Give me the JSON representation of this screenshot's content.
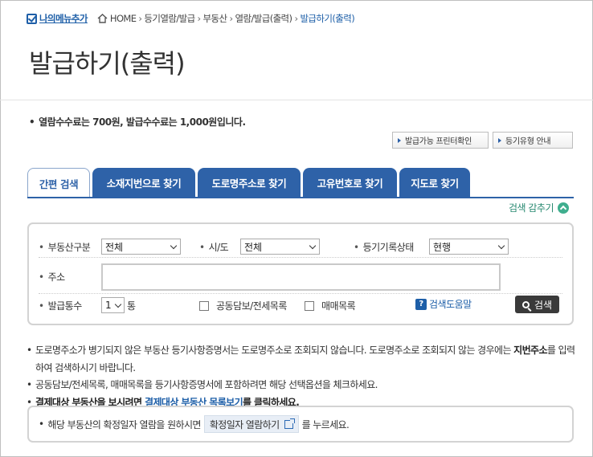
{
  "nav": {
    "my_menu": "나의메뉴추가",
    "breadcrumbs": [
      "HOME",
      "등기열람/발급",
      "부동산",
      "열람/발급(출력)",
      "발급하기(출력)"
    ]
  },
  "page": {
    "title": "발급하기(출력)",
    "fee_notice": "열람수수료는 700원, 발급수수료는 1,000원입니다."
  },
  "actions": {
    "printer_check": "발급가능 프린터확인",
    "registry_types": "등기유형 안내"
  },
  "tabs": [
    {
      "label": "간편 검색",
      "active": true
    },
    {
      "label": "소재지번으로 찾기",
      "active": false
    },
    {
      "label": "도로명주소로 찾기",
      "active": false
    },
    {
      "label": "고유번호로 찾기",
      "active": false
    },
    {
      "label": "지도로 찾기",
      "active": false
    }
  ],
  "search": {
    "fold_label": "검색 감추기",
    "property_type": {
      "label": "부동산구분",
      "value": "전체"
    },
    "province": {
      "label": "시/도",
      "value": "전체"
    },
    "record_status": {
      "label": "등기기록상태",
      "value": "현행"
    },
    "address": {
      "label": "주소",
      "value": ""
    },
    "copies": {
      "label": "발급통수",
      "value": "1",
      "unit": "통"
    },
    "joint_collateral": {
      "label": "공동담보/전세목록",
      "checked": false
    },
    "sale_list": {
      "label": "매매목록",
      "checked": false
    },
    "help_label": "검색도움말",
    "help_icon": "?",
    "search_button": "검색"
  },
  "notes": {
    "line1_a": "도로명주소가 병기되지 않은 부동산 등기사항증명서는 도로명주소로 조회되지 않습니다. 도로명주소로 조회되지 않는 경우에는 ",
    "line1_b": "지번주소",
    "line1_c": "를 입력하여 검색하시기 바랍니다.",
    "line2": "공동담보/전세목록, 매매목록을 등기사항증명서에 포함하려면 해당 선택옵션을 체크하세요.",
    "line3_a": "결제대상 부동산을 보시려면 ",
    "line3_link": "결제대상 부동산 목록보기",
    "line3_b": "를 클릭하세요."
  },
  "bottom_notice": {
    "before": "해당 부동산의 확정일자 열람을 원하시면",
    "button": "확정일자 열람하기",
    "after": "를 누르세요."
  }
}
